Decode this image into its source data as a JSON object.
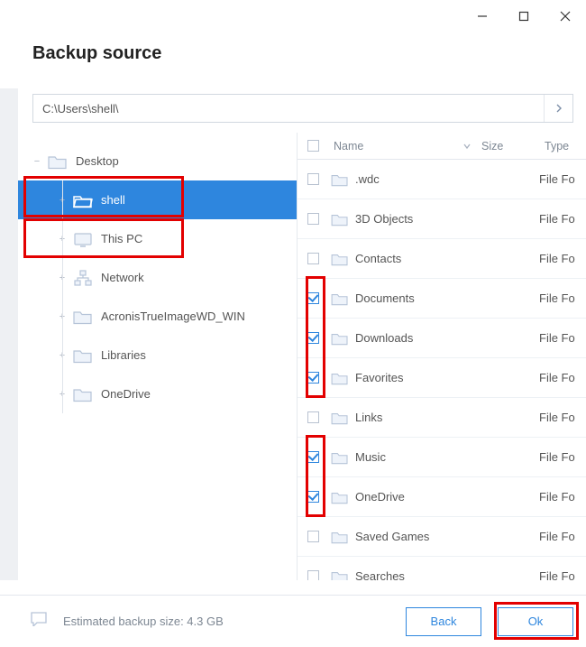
{
  "window": {
    "title": "Backup source"
  },
  "pathbar": {
    "value": "C:\\Users\\shell\\"
  },
  "tree": {
    "root": {
      "label": "Desktop",
      "icon": "folder-icon",
      "expander": "−"
    },
    "items": [
      {
        "label": "shell",
        "icon": "folder-open-icon",
        "expander": "+",
        "selected": true
      },
      {
        "label": "This PC",
        "icon": "monitor-icon",
        "expander": "+"
      },
      {
        "label": "Network",
        "icon": "network-icon",
        "expander": "+"
      },
      {
        "label": "AcronisTrueImageWD_WIN",
        "icon": "folder-icon",
        "expander": "+"
      },
      {
        "label": "Libraries",
        "icon": "folder-icon",
        "expander": "+"
      },
      {
        "label": "OneDrive",
        "icon": "folder-icon",
        "expander": "+"
      }
    ]
  },
  "list": {
    "columns": {
      "name": "Name",
      "size": "Size",
      "type": "Type"
    },
    "rows": [
      {
        "name": ".wdc",
        "type": "File Fo",
        "checked": false
      },
      {
        "name": "3D Objects",
        "type": "File Fo",
        "checked": false
      },
      {
        "name": "Contacts",
        "type": "File Fo",
        "checked": false
      },
      {
        "name": "Documents",
        "type": "File Fo",
        "checked": true
      },
      {
        "name": "Downloads",
        "type": "File Fo",
        "checked": true
      },
      {
        "name": "Favorites",
        "type": "File Fo",
        "checked": true
      },
      {
        "name": "Links",
        "type": "File Fo",
        "checked": false
      },
      {
        "name": "Music",
        "type": "File Fo",
        "checked": true
      },
      {
        "name": "OneDrive",
        "type": "File Fo",
        "checked": true
      },
      {
        "name": "Saved Games",
        "type": "File Fo",
        "checked": false
      },
      {
        "name": "Searches",
        "type": "File Fo",
        "checked": false
      }
    ]
  },
  "footer": {
    "estimate_label": "Estimated backup size: 4.3 GB",
    "back_label": "Back",
    "ok_label": "Ok"
  }
}
